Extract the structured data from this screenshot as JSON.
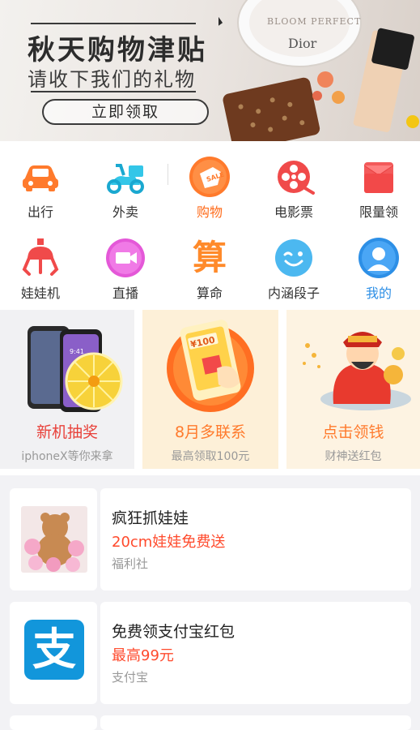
{
  "banner": {
    "title": "秋天购物津贴",
    "subtitle": "请收下我们的礼物",
    "cta": "立即领取",
    "product_text": "BLOOM PERFECT",
    "brand_text": "Dior"
  },
  "grid": {
    "row1": [
      {
        "label": "出行",
        "icon": "car-icon"
      },
      {
        "label": "外卖",
        "icon": "scooter-icon"
      },
      {
        "label": "购物",
        "icon": "sale-tag-icon",
        "active": true
      },
      {
        "label": "电影票",
        "icon": "film-reel-icon"
      },
      {
        "label": "限量领",
        "icon": "red-envelope-icon"
      }
    ],
    "row2": [
      {
        "label": "娃娃机",
        "icon": "claw-machine-icon"
      },
      {
        "label": "直播",
        "icon": "video-camera-icon"
      },
      {
        "label": "算命",
        "icon": "fortune-character-icon",
        "glyph": "算"
      },
      {
        "label": "内涵段子",
        "icon": "wink-face-icon"
      },
      {
        "label": "我的",
        "icon": "user-avatar-icon"
      }
    ]
  },
  "promos": [
    {
      "title": "新机抽奖",
      "subtitle": "iphoneX等你来拿",
      "icon": "phone-lottery-icon",
      "screen_time": "9:41"
    },
    {
      "title": "8月多联系",
      "subtitle": "最高领取100元",
      "icon": "phone-money-icon",
      "amount": "¥100"
    },
    {
      "title": "点击领钱",
      "subtitle": "财神送红包",
      "icon": "god-of-wealth-icon"
    }
  ],
  "cards": [
    {
      "title": "疯狂抓娃娃",
      "highlight": "20cm娃娃免费送",
      "source": "福利社",
      "thumb": "plush-toys-thumbnail"
    },
    {
      "title": "免费领支付宝红包",
      "highlight": "最高99元",
      "source": "支付宝",
      "thumb": "alipay-logo",
      "logo_glyph": "支"
    }
  ],
  "colors": {
    "accent_orange": "#ff6b1a",
    "accent_red": "#ff4a2c",
    "alipay_blue": "#1296db",
    "me_blue": "#2d8fe6"
  }
}
